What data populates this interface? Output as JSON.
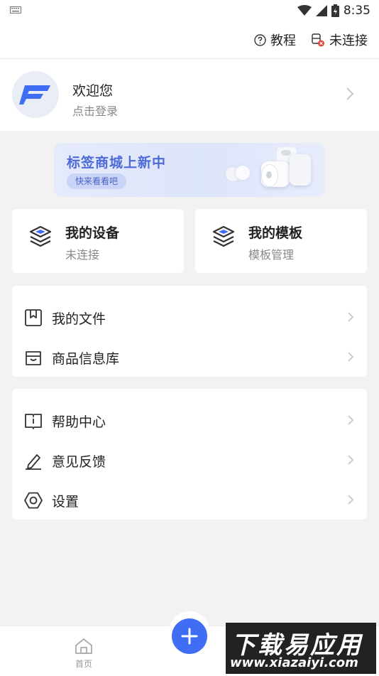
{
  "status_bar": {
    "time": "8:35"
  },
  "top_bar": {
    "tutorial": "教程",
    "connection": "未连接"
  },
  "profile": {
    "welcome": "欢迎您",
    "login": "点击登录"
  },
  "banner": {
    "title": "标签商城上新中",
    "button": "快来看看吧"
  },
  "cards": [
    {
      "title": "我的设备",
      "subtitle": "未连接"
    },
    {
      "title": "我的模板",
      "subtitle": "模板管理"
    }
  ],
  "list_group_1": [
    {
      "label": "我的文件",
      "icon": "bookmark-file-icon"
    },
    {
      "label": "商品信息库",
      "icon": "inbox-icon"
    }
  ],
  "list_group_2": [
    {
      "label": "帮助中心",
      "icon": "book-info-icon"
    },
    {
      "label": "意见反馈",
      "icon": "pen-icon"
    },
    {
      "label": "设置",
      "icon": "hexagon-settings-icon"
    }
  ],
  "bottom_nav": {
    "home": "首页"
  },
  "watermark": {
    "title": "下载易应用",
    "url": "www.xiazaiyi.com"
  },
  "colors": {
    "accent": "#3f6ef4",
    "banner_text": "#4d6ad8"
  }
}
